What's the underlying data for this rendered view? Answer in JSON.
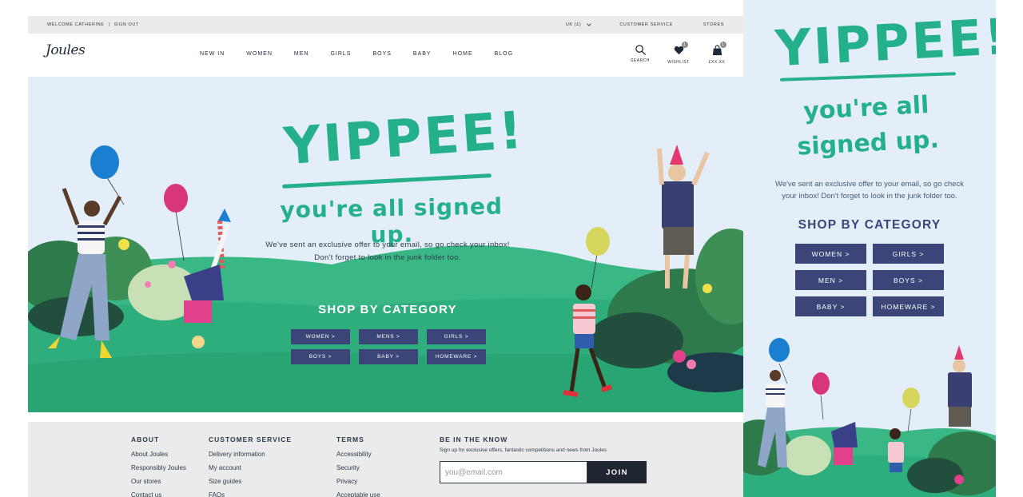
{
  "colors": {
    "brand_green": "#25b08c",
    "navy": "#3b4577",
    "sky": "#e3eef8",
    "grass": "#2fae7d"
  },
  "topbar": {
    "welcome": "WELCOME CATHERINE",
    "divider": "|",
    "sign_out": "SIGN OUT",
    "country": "UK (£)",
    "customer_service": "CUSTOMER SERVICE",
    "stores": "STORES"
  },
  "brand": {
    "logo": "Joules"
  },
  "nav": {
    "items": [
      "NEW IN",
      "WOMEN",
      "MEN",
      "GIRLS",
      "BOYS",
      "BABY",
      "HOME",
      "BLOG"
    ]
  },
  "nav_icons": {
    "search": {
      "label": "SEARCH",
      "icon": "search-icon"
    },
    "wishlist": {
      "label": "WISHLIST",
      "count": "1",
      "icon": "heart-icon"
    },
    "bag": {
      "label": "£XX.XX",
      "count": "1",
      "icon": "bag-icon"
    }
  },
  "hero": {
    "headline": "YIPPEE!",
    "subhead": "you're all signed up.",
    "message_line1": "We've sent an exclusive offer to your email, so go check your inbox!",
    "message_line2": "Don't forget to look in the junk folder too.",
    "shop_title": "SHOP BY CATEGORY",
    "categories": [
      "WOMEN >",
      "MENS >",
      "GIRLS >",
      "BOYS >",
      "BABY >",
      "HOMEWARE >"
    ]
  },
  "footer": {
    "about": {
      "heading": "ABOUT",
      "links": [
        "About Joules",
        "Responsibly Joules",
        "Our stores",
        "Contact us"
      ]
    },
    "customer_service": {
      "heading": "CUSTOMER SERVICE",
      "links": [
        "Delivery information",
        "My account",
        "Size guides",
        "FAQs"
      ]
    },
    "terms": {
      "heading": "TERMS",
      "links": [
        "Accessibility",
        "Security",
        "Privacy",
        "Acceptable use"
      ]
    },
    "newsletter": {
      "heading": "BE IN THE KNOW",
      "text": "Sign up for exclusive offers, fantastic competitions and news from Joules",
      "placeholder": "you@email.com",
      "button": "JOIN"
    }
  },
  "mobile": {
    "headline": "YIPPEE!",
    "subhead_line1": "you're all",
    "subhead_line2": "signed up.",
    "message_line1": "We've sent an exclusive offer to your email, so go check",
    "message_line2": "your inbox! Don't forget to look in the junk folder too.",
    "shop_title": "SHOP BY CATEGORY",
    "categories": [
      "WOMEN >",
      "GIRLS >",
      "MEN >",
      "BOYS >",
      "BABY >",
      "HOMEWARE >"
    ]
  }
}
